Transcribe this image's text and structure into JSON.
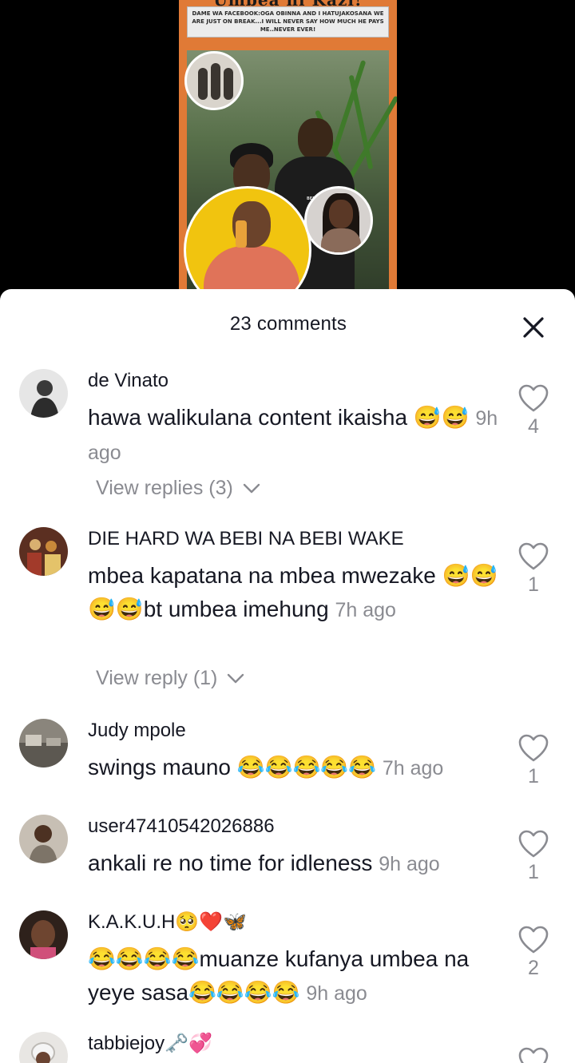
{
  "video": {
    "poster_title": "Umbea ni Kazi!",
    "poster_caption": "DAME WA FACEBOOK:OGA OBINNA AND I HATUJAKOSANA WE ARE JUST ON BREAK...I WILL NEVER SAY HOW MUCH HE PAYS ME..NEVER EVER!",
    "shirt_text": "BEBI WA BEBI"
  },
  "sheet": {
    "title": "23 comments",
    "close_icon": "close-icon"
  },
  "comments": [
    {
      "username": "de Vinato",
      "text": "hawa walikulana content ikaisha 😅😅",
      "time": "9h ago",
      "likes": "4",
      "replies": "View replies (3)",
      "avatar_color": "#d9d9d9"
    },
    {
      "username": "DIE HARD WA BEBI NA  BEBI WAKE",
      "text": "mbea kapatana na mbea mwezake 😅😅😅😅bt umbea imehung",
      "time": "7h ago",
      "likes": "1",
      "replies": "View reply (1)",
      "avatar_color": "#6b3a2a"
    },
    {
      "username": "Judy mpole",
      "text": "swings mauno 😂😂😂😂😂",
      "time": "7h ago",
      "likes": "1",
      "avatar_color": "#7b776f"
    },
    {
      "username": "user47410542026886",
      "text": "ankali re no time for idleness",
      "time": "9h ago",
      "likes": "1",
      "avatar_color": "#b3a89b"
    },
    {
      "username": "K.A.K.U.H🥺❤️🦋",
      "text": "😂😂😂😂muanze kufanya umbea na yeye sasa😂😂😂😂",
      "time": "9h ago",
      "likes": "2",
      "avatar_color": "#3a2a22"
    },
    {
      "username": "tabbiejoy🗝️💞",
      "avatar_color": "#c9c6c2"
    }
  ]
}
